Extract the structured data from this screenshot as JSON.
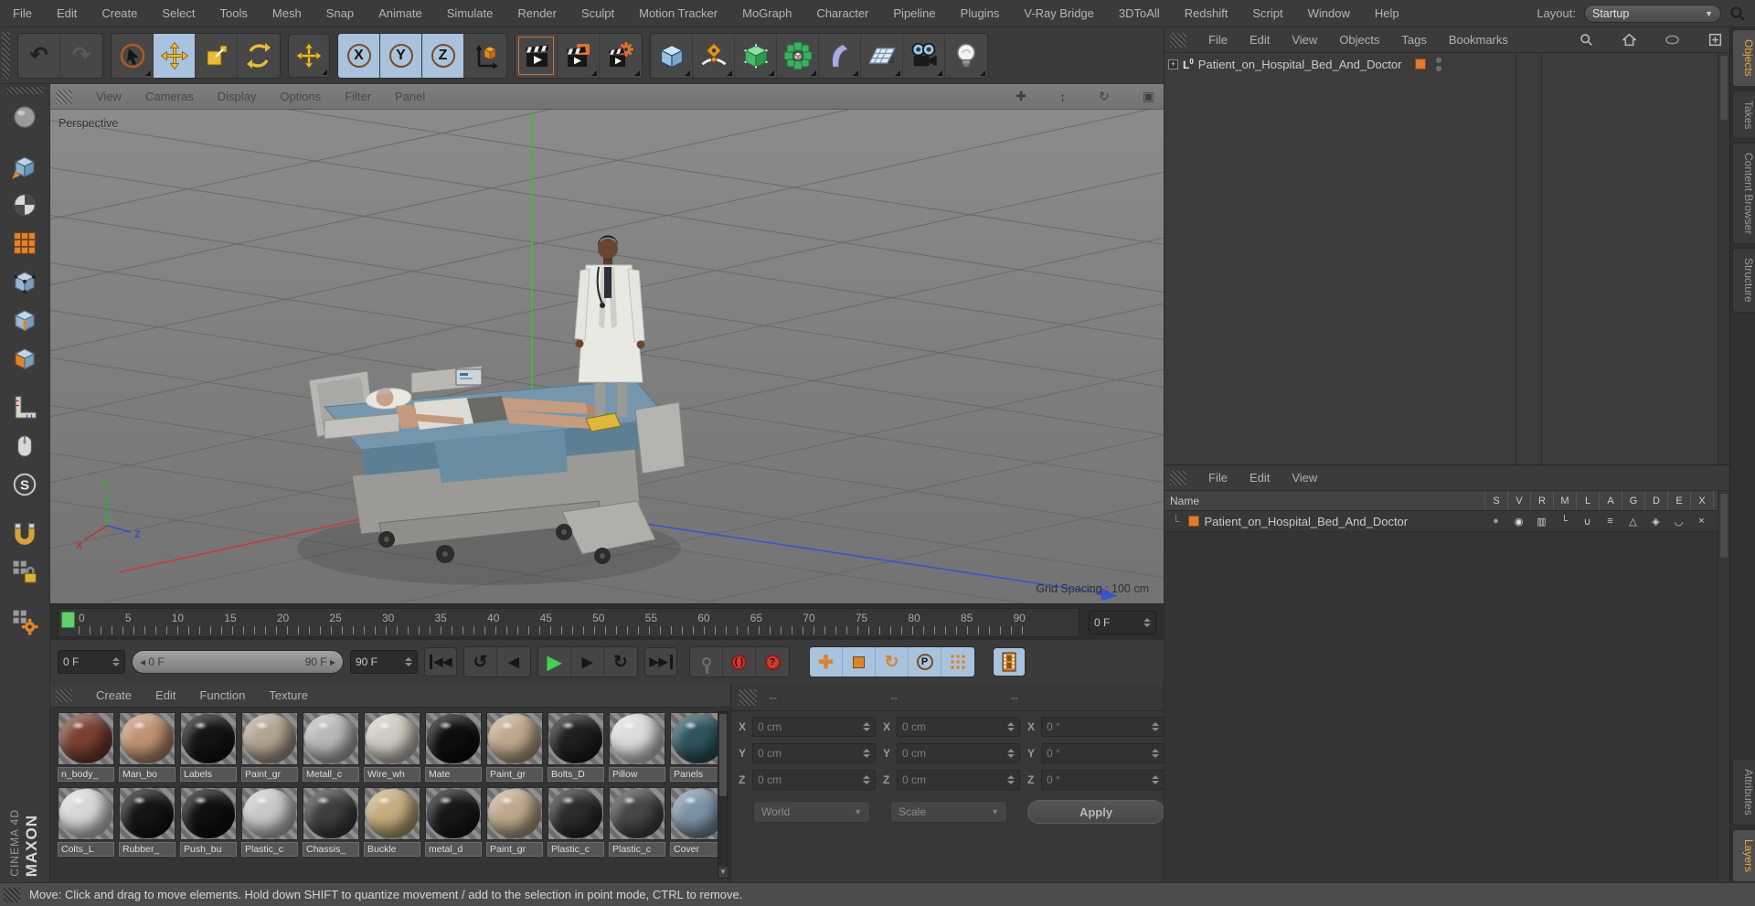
{
  "menubar": {
    "items": [
      "File",
      "Edit",
      "Create",
      "Select",
      "Tools",
      "Mesh",
      "Snap",
      "Animate",
      "Simulate",
      "Render",
      "Sculpt",
      "Motion Tracker",
      "MoGraph",
      "Character",
      "Pipeline",
      "Plugins",
      "V-Ray Bridge",
      "3DToAll",
      "Redshift",
      "Script",
      "Window",
      "Help"
    ],
    "layout_label": "Layout:",
    "layout_value": "Startup"
  },
  "viewport": {
    "menu": [
      "View",
      "Cameras",
      "Display",
      "Options",
      "Filter",
      "Panel"
    ],
    "label": "Perspective",
    "grid_spacing": "Grid Spacing : 100 cm"
  },
  "timeline": {
    "ticks": [
      "0",
      "5",
      "10",
      "15",
      "20",
      "25",
      "30",
      "35",
      "40",
      "45",
      "50",
      "55",
      "60",
      "65",
      "70",
      "75",
      "80",
      "85",
      "90"
    ],
    "current_frame": "0 F",
    "range_start": "0 F",
    "range_end": "90 F",
    "end_frame": "90 F"
  },
  "object_manager": {
    "menu": [
      "File",
      "Edit",
      "View",
      "Objects",
      "Tags",
      "Bookmarks"
    ],
    "object_name": "Patient_on_Hospital_Bed_And_Doctor"
  },
  "layer_manager": {
    "menu": [
      "File",
      "Edit",
      "View"
    ],
    "name_header": "Name",
    "columns": [
      "S",
      "V",
      "R",
      "M",
      "L",
      "A",
      "G",
      "D",
      "E",
      "X"
    ],
    "row_name": "Patient_on_Hospital_Bed_And_Doctor"
  },
  "materials": {
    "menu": [
      "Create",
      "Edit",
      "Function",
      "Texture"
    ],
    "row1": [
      {
        "name": "n_body_",
        "color": "#7a4033"
      },
      {
        "name": "Man_bo",
        "color": "#c29274"
      },
      {
        "name": "Labels",
        "color": "#141414"
      },
      {
        "name": "Paint_gr",
        "color": "#b3a492"
      },
      {
        "name": "Metall_c",
        "color": "#b9b9b9"
      },
      {
        "name": "Wire_wh",
        "color": "#cfcbc2"
      },
      {
        "name": "Mate",
        "color": "#0e0e0e"
      },
      {
        "name": "Paint_gr",
        "color": "#bfa98e"
      },
      {
        "name": "Bolts_D",
        "color": "#1f1f1f"
      },
      {
        "name": "Pillow",
        "color": "#dcdcdc"
      },
      {
        "name": "Panels",
        "color": "#2f5560"
      }
    ],
    "row2": [
      {
        "name": "Colts_L",
        "color": "#d8d8d8"
      },
      {
        "name": "Rubber_",
        "color": "#151515"
      },
      {
        "name": "Push_bu",
        "color": "#101010"
      },
      {
        "name": "Plastic_c",
        "color": "#c9c9c9"
      },
      {
        "name": "Chassis_",
        "color": "#3f3f3f"
      },
      {
        "name": "Buckle",
        "color": "#c4ad7e"
      },
      {
        "name": "metal_d",
        "color": "#181818"
      },
      {
        "name": "Paint_gr",
        "color": "#bfa98e"
      },
      {
        "name": "Plastic_c",
        "color": "#2c2c2c"
      },
      {
        "name": "Plastic_c",
        "color": "#474747"
      },
      {
        "name": "Cover",
        "color": "#7d93a6"
      }
    ]
  },
  "coordinates": {
    "headers": [
      "--",
      "--",
      "--"
    ],
    "axes": [
      "X",
      "Y",
      "Z"
    ],
    "position_values": [
      "0 cm",
      "0 cm",
      "0 cm"
    ],
    "size_values": [
      "0 cm",
      "0 cm",
      "0 cm"
    ],
    "rotation_values": [
      "0 °",
      "0 °",
      "0 °"
    ],
    "space_dropdown": "World",
    "mode_dropdown": "Scale",
    "apply_label": "Apply"
  },
  "side_tabs": [
    {
      "label": "Objects",
      "active": true
    },
    {
      "label": "Takes",
      "active": false
    },
    {
      "label": "Content Browser",
      "active": false
    },
    {
      "label": "Structure",
      "active": false
    },
    {
      "label": "Attributes",
      "active": false,
      "gap_before": true
    },
    {
      "label": "Layers",
      "active": true
    }
  ],
  "statusbar": {
    "text": "Move: Click and drag to move elements. Hold down SHIFT to quantize movement / add to the selection in point mode, CTRL to remove."
  },
  "brand": {
    "maxon": "MAXON",
    "cinema": "CINEMA 4D"
  }
}
